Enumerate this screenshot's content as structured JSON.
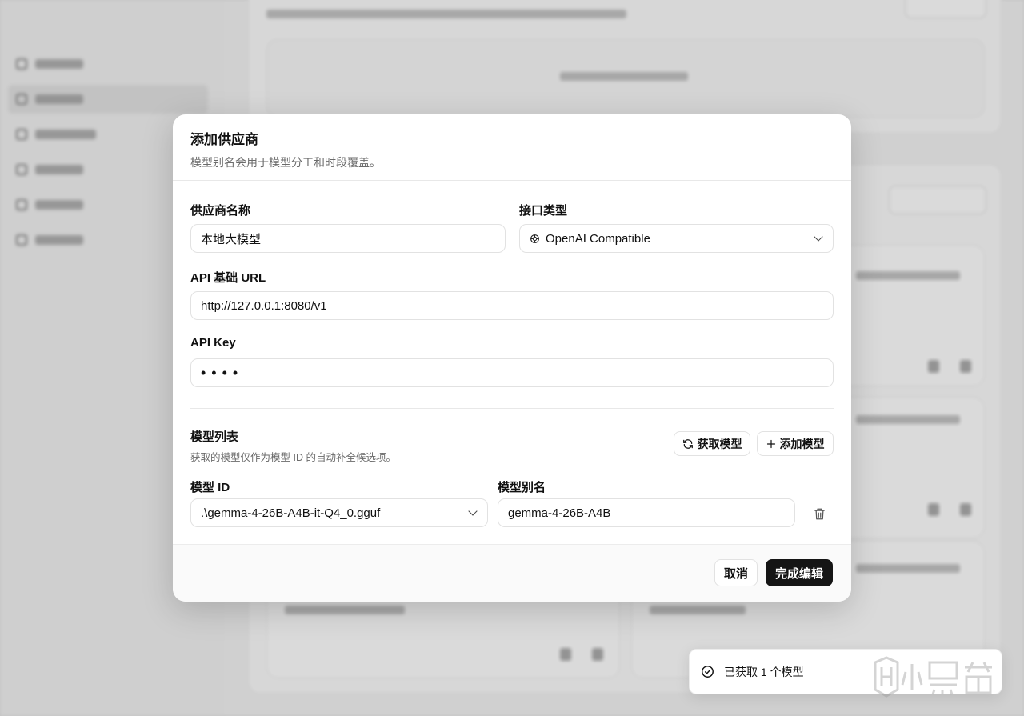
{
  "dialog": {
    "title": "添加供应商",
    "subtitle": "模型别名会用于模型分工和时段覆盖。",
    "provider_name_label": "供应商名称",
    "provider_name_value": "本地大模型",
    "api_type_label": "接口类型",
    "api_type_value": "OpenAI Compatible",
    "api_type_icon": "openai-icon",
    "base_url_label": "API 基础 URL",
    "base_url_value": "http://127.0.0.1:8080/v1",
    "api_key_label": "API Key",
    "api_key_value": "••••",
    "models_title": "模型列表",
    "models_hint": "获取的模型仅作为模型 ID 的自动补全候选项。",
    "fetch_models_label": "获取模型",
    "add_model_label": "添加模型",
    "model_id_label": "模型 ID",
    "model_alias_label": "模型别名",
    "models": [
      {
        "id": ".\\gemma-4-26B-A4B-it-Q4_0.gguf",
        "alias": "gemma-4-26B-A4B"
      }
    ],
    "cancel_label": "取消",
    "done_label": "完成编辑"
  },
  "toast": {
    "message": "已获取 1 个模型",
    "icon": "check-circle-icon"
  },
  "colors": {
    "primary_button": "#151515",
    "overlay": "#bdbdbd",
    "dialog_bg": "#ffffff"
  }
}
